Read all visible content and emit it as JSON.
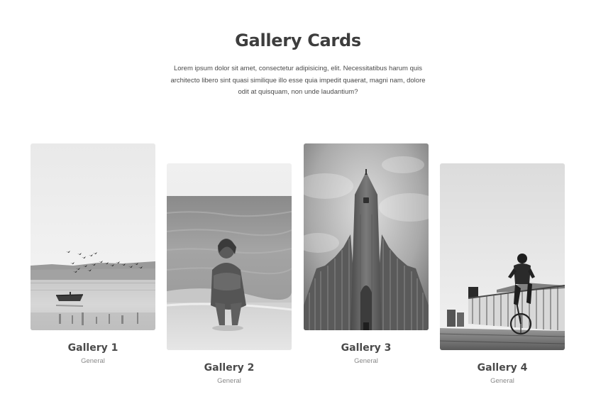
{
  "header": {
    "title": "Gallery Cards",
    "description": "Lorem ipsum dolor sit amet, consectetur adipisicing, elit. Necessitatibus harum quis architecto libero sint quasi similique illo esse quia impedit quaerat, magni nam, dolore odit at quisquam, non unde laudantium?"
  },
  "cards": [
    {
      "title": "Gallery 1",
      "category": "General",
      "image": "lake-birds-boat-photo"
    },
    {
      "title": "Gallery 2",
      "category": "General",
      "image": "woman-on-beach-photo"
    },
    {
      "title": "Gallery 3",
      "category": "General",
      "image": "church-tower-photo"
    },
    {
      "title": "Gallery 4",
      "category": "General",
      "image": "cyclist-on-bridge-photo"
    }
  ]
}
